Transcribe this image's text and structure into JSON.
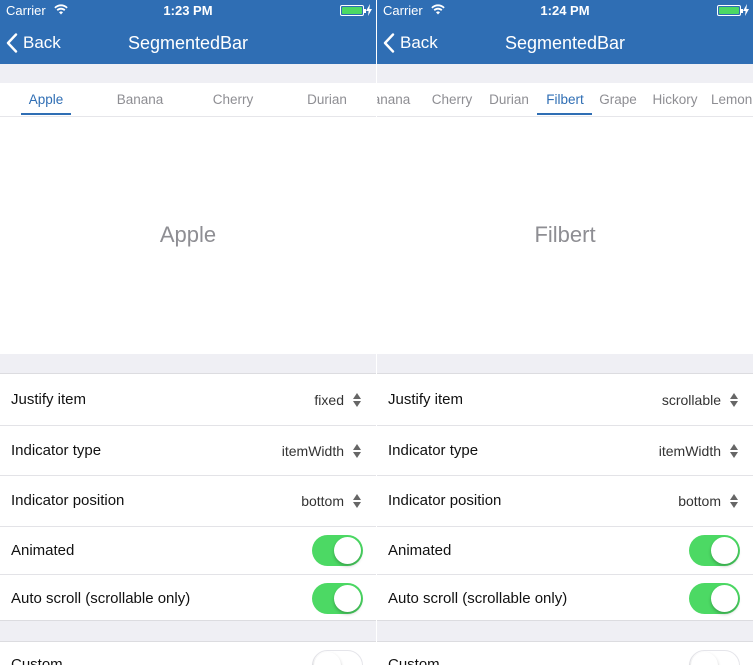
{
  "screens": [
    {
      "status": {
        "carrier": "Carrier",
        "time": "1:23 PM"
      },
      "nav": {
        "back_label": "Back",
        "title": "SegmentedBar"
      },
      "segments": [
        {
          "label": "Apple",
          "active": true
        },
        {
          "label": "Banana",
          "active": false
        },
        {
          "label": "Cherry",
          "active": false
        },
        {
          "label": "Durian",
          "active": false
        }
      ],
      "content_label": "Apple",
      "settings": {
        "justify_item": {
          "label": "Justify item",
          "value": "fixed"
        },
        "indicator_type": {
          "label": "Indicator type",
          "value": "itemWidth"
        },
        "indicator_position": {
          "label": "Indicator position",
          "value": "bottom"
        },
        "animated": {
          "label": "Animated",
          "on": true
        },
        "auto_scroll": {
          "label": "Auto scroll (scrollable only)",
          "on": true
        },
        "custom": {
          "label": "Custom",
          "on": false
        }
      }
    },
    {
      "status": {
        "carrier": "Carrier",
        "time": "1:24 PM"
      },
      "nav": {
        "back_label": "Back",
        "title": "SegmentedBar"
      },
      "segments": [
        {
          "label": "Banana",
          "active": false
        },
        {
          "label": "Cherry",
          "active": false
        },
        {
          "label": "Durian",
          "active": false
        },
        {
          "label": "Filbert",
          "active": true
        },
        {
          "label": "Grape",
          "active": false
        },
        {
          "label": "Hickory",
          "active": false
        },
        {
          "label": "Lemon",
          "active": false
        }
      ],
      "content_label": "Filbert",
      "settings": {
        "justify_item": {
          "label": "Justify item",
          "value": "scrollable"
        },
        "indicator_type": {
          "label": "Indicator type",
          "value": "itemWidth"
        },
        "indicator_position": {
          "label": "Indicator position",
          "value": "bottom"
        },
        "animated": {
          "label": "Animated",
          "on": true
        },
        "auto_scroll": {
          "label": "Auto scroll (scrollable only)",
          "on": true
        },
        "custom": {
          "label": "Custom",
          "on": false
        }
      }
    }
  ],
  "colors": {
    "nav_bar": "#2f6eb4",
    "accent": "#2f6eb4",
    "toggle_on": "#4cd964",
    "background_gray": "#efeff4"
  },
  "icons": [
    "wifi-icon",
    "battery-icon",
    "charging-bolt-icon",
    "back-chevron-icon",
    "up-down-arrows-icon"
  ]
}
